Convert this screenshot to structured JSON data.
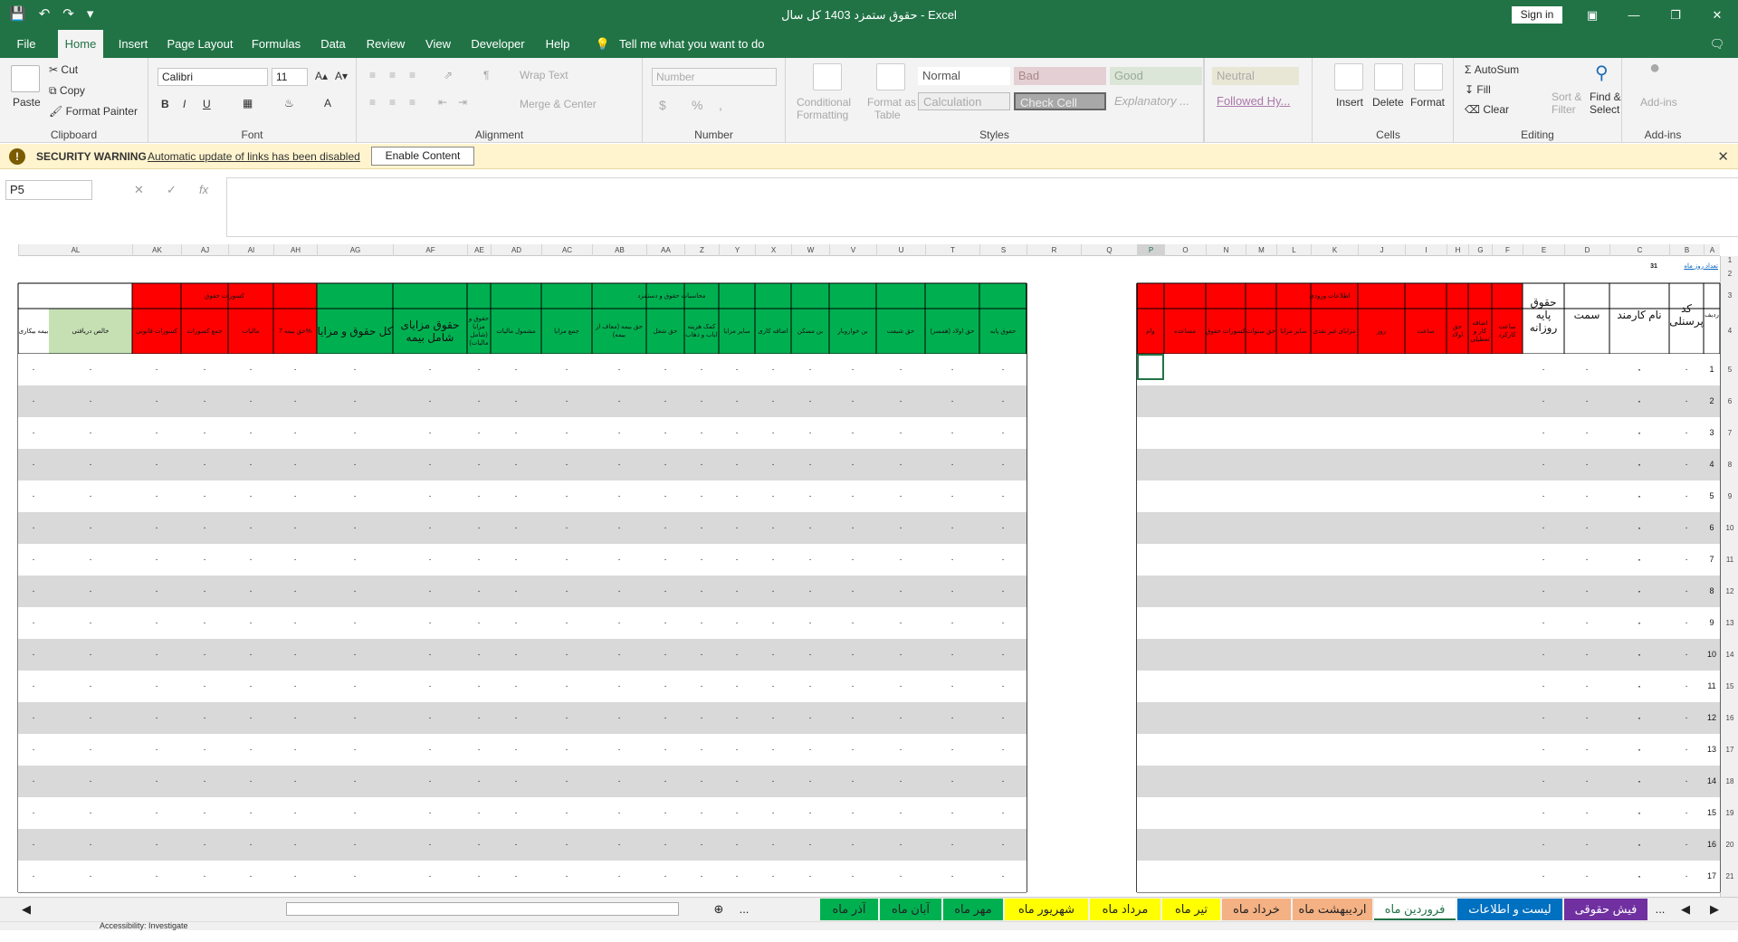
{
  "title": {
    "doc_title": "حقوق  ستمزد 1403 کل سال  -  Excel",
    "signin": "Sign in"
  },
  "menu_tabs": [
    "File",
    "Home",
    "Insert",
    "Page Layout",
    "Formulas",
    "Data",
    "Review",
    "View",
    "Developer",
    "Help"
  ],
  "tellme": "Tell me what you want to do",
  "ribbon": {
    "clipboard": {
      "paste": "Paste",
      "cut": "Cut",
      "copy": "Copy",
      "format_painter": "Format Painter",
      "label": "Clipboard"
    },
    "font": {
      "name": "Calibri",
      "size": "11",
      "label": "Font",
      "bold": "B",
      "italic": "I",
      "underline": "U"
    },
    "alignment": {
      "wrap": "Wrap Text",
      "merge": "Merge & Center",
      "label": "Alignment"
    },
    "number": {
      "format": "Number",
      "currency": "$",
      "percent": "%",
      "comma": ",",
      "label": "Number"
    },
    "styles": {
      "cond1": "Conditional",
      "cond2": "Formatting",
      "table1": "Format as",
      "table2": "Table",
      "normal": "Normal",
      "bad": "Bad",
      "good": "Good",
      "neutral": "Neutral",
      "calculation": "Calculation",
      "check": "Check Cell",
      "explanatory": "Explanatory ...",
      "followed": "Followed Hy...",
      "label": "Styles"
    },
    "cells": {
      "insert": "Insert",
      "delete": "Delete",
      "format": "Format",
      "label": "Cells"
    },
    "editing": {
      "autosum": "AutoSum",
      "fill": "Fill",
      "clear": "Clear",
      "sort1": "Sort &",
      "sort2": "Filter",
      "find1": "Find &",
      "find2": "Select",
      "label": "Editing"
    },
    "addins": {
      "addins": "Add-ins",
      "label": "Add-ins"
    }
  },
  "security": {
    "title": "SECURITY WARNING",
    "message": "Automatic update of links has been disabled",
    "button": "Enable Content"
  },
  "formula_bar": {
    "name_box": "P5",
    "fx": "fx",
    "value": ""
  },
  "columns": {
    "right_block": [
      "A",
      "B",
      "C",
      "D",
      "E",
      "F",
      "G",
      "H",
      "I",
      "J",
      "K",
      "L",
      "M",
      "N",
      "O",
      "P"
    ],
    "middle": [
      "Q",
      "R"
    ],
    "left_block": [
      "S",
      "T",
      "U",
      "V",
      "W",
      "X",
      "Y",
      "Z",
      "AA",
      "AB",
      "AC",
      "AD",
      "AE",
      "AF",
      "AG",
      "AH",
      "AI",
      "AJ",
      "AK",
      "AL",
      "AM"
    ],
    "selected": "P"
  },
  "sheet": {
    "days_label": "تعداد روز ماه",
    "days_value": "31",
    "header_red_right": "اطلاعات ورودی",
    "header_green": "محاسبات حقوق و دستمزد",
    "header_red_left": "کسورات حقوق",
    "col_row": "ردیف",
    "col_code": "کد پرسنلی",
    "col_name": "نام کارمند",
    "col_title": "سمت",
    "col_daily": "حقوق پایه روزانه",
    "sub_right": [
      "ساعت کارکرد",
      "اضافه کار و تعطیلی",
      "حق اولاد",
      "ساعت",
      "روز",
      "مزایای غیر نقدی",
      "سایر مزایا",
      "حق سنوات",
      "کسورات حقوق",
      "مساعده",
      "وام",
      "اقساط وام",
      "معافیت مالیاتی",
      "حق بیمه سهم کارفرما",
      "مرخصی استفاده نشده"
    ],
    "sub_green": [
      "حقوق پایه",
      "حق اولاد (همسر)",
      "حق شیفت",
      "بن خواروبار",
      "بن مسکن",
      "اضافه کاری",
      "سایر مزایا",
      "کمک هزینه ایاب و ذهاب",
      "حق شغل",
      "حق بیمه (معاف از بیمه)",
      "جمع مزایا",
      "مشمول مالیات",
      "حقوق و مزایا (شامل مالیات)",
      "حقوق مزایای شامل بیمه",
      "کل حقوق و مزایا"
    ],
    "sub_left": [
      "حق بیمه 7%",
      "مالیات",
      "جمع کسورات",
      "کسورات قانونی",
      "خالص دریافتی",
      "بیمه بیکاری"
    ],
    "cell_value": "٠",
    "row_numbers": [
      "1",
      "2",
      "3",
      "4",
      "5",
      "6",
      "7",
      "8",
      "9",
      "10",
      "11",
      "12",
      "13",
      "14",
      "15",
      "16",
      "17",
      "18",
      "19",
      "20",
      "21"
    ]
  },
  "sheet_tabs": [
    "فیش حقوقی",
    "لیست و اطلاعات  کارکنان",
    "فروردین ماه",
    "اردیبهشت ماه",
    "خرداد ماه",
    "تیر ماه",
    "مرداد ماه",
    "شهریور ماه",
    "مهر ماه",
    "آبان ماه",
    "آذر ماه"
  ],
  "sheet_tab_colors": [
    "#7030a0",
    "#0070c0",
    "#ffffff",
    "#f4b183",
    "#f4b183",
    "#ffff00",
    "#ffff00",
    "#ffff00",
    "#00b050",
    "#00b050",
    "#00b050"
  ],
  "status": {
    "accessibility": "Accessibility: Investigate"
  }
}
